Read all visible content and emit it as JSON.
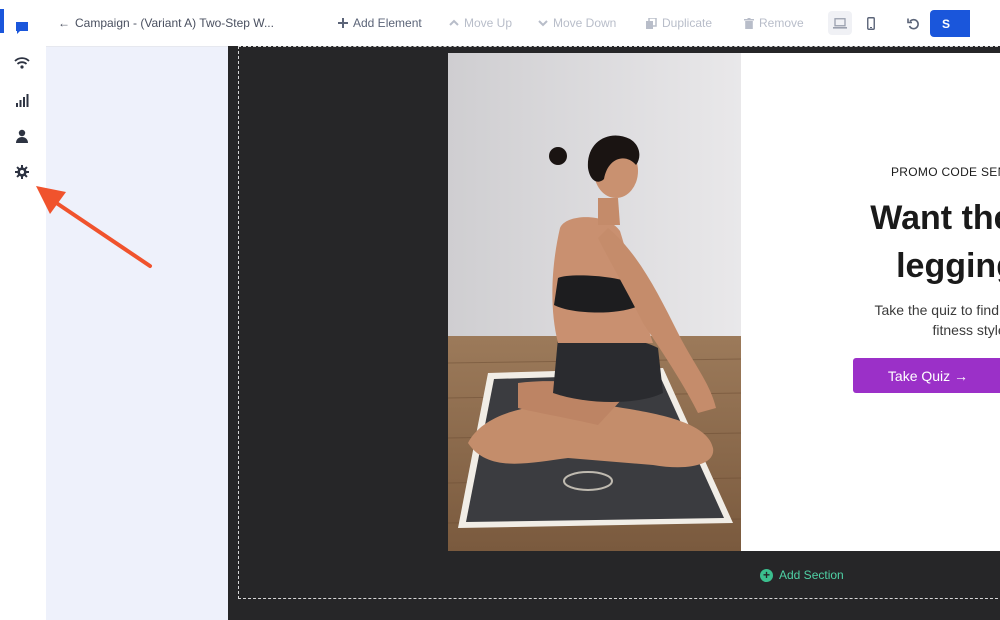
{
  "toolbar": {
    "back_label": "Campaign - (Variant A) Two-Step W...",
    "add_element": "Add Element",
    "move_up": "Move Up",
    "move_down": "Move Down",
    "duplicate": "Duplicate",
    "remove": "Remove",
    "save_label": "S"
  },
  "sidebar": {
    "items": [
      {
        "icon": "chat-icon",
        "active": true
      },
      {
        "icon": "wifi-icon",
        "active": false
      },
      {
        "icon": "bar-chart-icon",
        "active": false
      },
      {
        "icon": "user-icon",
        "active": false
      },
      {
        "icon": "gear-icon",
        "active": false
      }
    ]
  },
  "canvas": {
    "eyebrow": "PROMO CODE SEN",
    "headline_line1": "Want the pe",
    "headline_line2": "leggings",
    "subtext_line1": "Take the quiz to find the best le",
    "subtext_line2": "fitness style:",
    "quiz_button": "Take Quiz →",
    "add_section": "Add Section"
  },
  "colors": {
    "accent": "#1a56db",
    "quiz_button": "#9b30c8",
    "canvas_bg": "#262628",
    "panel_bg": "#eef1fb",
    "add_section": "#4fd1a5",
    "annotation_arrow": "#f0532d"
  }
}
